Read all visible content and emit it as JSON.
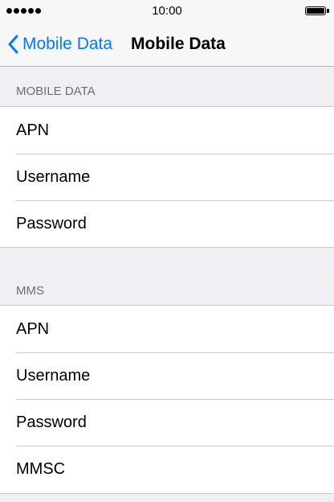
{
  "status_bar": {
    "time": "10:00",
    "battery_level": 1.0
  },
  "nav": {
    "back_label": "Mobile Data",
    "title": "Mobile Data"
  },
  "sections": [
    {
      "header": "MOBILE DATA",
      "rows": [
        "APN",
        "Username",
        "Password"
      ]
    },
    {
      "header": "MMS",
      "rows": [
        "APN",
        "Username",
        "Password",
        "MMSC"
      ]
    }
  ],
  "colors": {
    "accent": "#007aff",
    "background": "#efeff4",
    "separator": "#c8c7cc",
    "section_header_text": "#6d6d72"
  }
}
